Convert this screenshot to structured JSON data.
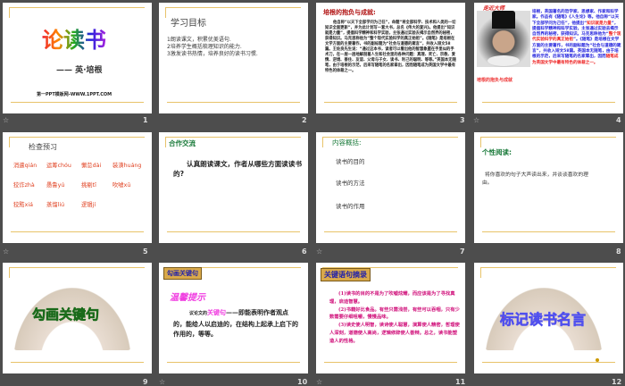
{
  "slides": [
    {
      "number": "1",
      "title": "论读书",
      "author": "—— 英·培根",
      "footer": "第一PPT模板网-WWW.1PPT.COM"
    },
    {
      "number": "2",
      "title": "学习目标",
      "lines": [
        "1朗读课文，积累优美语句.",
        "2培养学生概括梳理知识的能力.",
        "3激发读书热情，培养良好的读书习惯."
      ]
    },
    {
      "number": "3",
      "title": "培根的抱负与成就:",
      "body": "他自称“以天下全部学问为己任”，命题“将全部科学、技术和人类的一切知识全面更新”，并为此计划写一套大书，总名《伟大的复兴》。他提出“知识就是力量”，提倡科学精神和科学实验，主张通过实验去揭示自然界的秘密，获得知识。马克思称他为“整个现代实验科学的真正始祖”。《随笔》是培根在文学方面的主要著作，书的副标题为“社会与道德的箴言”，共收入短文58篇。王佐良先生说：“通过这本书，读者可以看出他的智慧象握在手里似的手术刀，在一层一层地解剖着人生和社会里的各种问题：真理、死亡、宗教、爱情、逆境、善住、友谊、父母与子女、读书、利己的聪明、等等。”英国本无随笔，由于培根的示范，后来写随笔的名家辈出，因而随笔成为英国文学中最有特色的体裁之一。"
    },
    {
      "number": "4",
      "title": "走近大师",
      "caption": "培根的抱负与成就",
      "body_a": "培根，英国著名的哲学家、思想家、作家和科学家。作品有《随笔》《人生论》等。他自称“以天下全部学问为己任”，他提出“",
      "hl1": "知识就是力量",
      "body_b": "”，提倡科学精神和科学实验，主张通过实验去揭示自然界的秘密，获得知识。马克思称他为“",
      "hl2": "整个现代实验科学的真正始祖",
      "body_c": "”。《随笔》是培根在文学方面的主要著作，书的副标题为“社会与道德的箴言”，共收入短文58篇。英国本无随笔，由于培根的示范，后来写随笔的名家辈出，因而",
      "hl3": "随笔成为英国文学中最有特色的体裁之一。"
    },
    {
      "number": "5",
      "title": "检查预习",
      "words": [
        [
          "消遣qián",
          "运筹chóu",
          "懈怠dài",
          "装潢huáng"
        ],
        [
          "狡诈zhà",
          "愚鲁yú",
          "挑剔tī",
          "吹嘘xū"
        ],
        [
          "狡黠xiá",
          "蒸馏liú",
          "逻辑jí"
        ]
      ]
    },
    {
      "number": "6",
      "title": "合作交流",
      "body": "认真朗读课文，作者从哪些方面读读书的?"
    },
    {
      "number": "7",
      "title": "内容概括:",
      "items": [
        "读书的目的",
        "读书的方法",
        "读书的作用"
      ]
    },
    {
      "number": "8",
      "title": "个性阅读:",
      "body": "将你喜欢的句子大声读出来，并谈谈喜欢的理由。"
    },
    {
      "number": "9",
      "title": "勾画关键句"
    },
    {
      "number": "10",
      "banner": "勾画关键句",
      "tip": "温馨提示",
      "lead": "议论文的",
      "key": "关键句",
      "body": "——即能表明作者观点的，能给人以启迪的，在结构上起承上启下的作用的，等等。"
    },
    {
      "number": "11",
      "banner": "关键语句摘录",
      "items": [
        "(1)读书的目的不是为了吹嘘炫耀，而应该是为了寻找真理，启迪智慧。",
        "(2)书籍好比食品。有些只需浅尝，有些可以吞咽，只有少数需要仔细咀嚼，慢慢品味。",
        "(3)读史使人明智，读诗使人聪慧，演算使人精密，哲理使人深刻，道德使人高尚，逻辑修辞使人善辩。总之，读书能塑造人的性格。"
      ]
    },
    {
      "number": "12",
      "title": "标记读书名言"
    }
  ],
  "colors": {
    "background": "#4d4d4d",
    "accent_line": "#e8c36a"
  }
}
